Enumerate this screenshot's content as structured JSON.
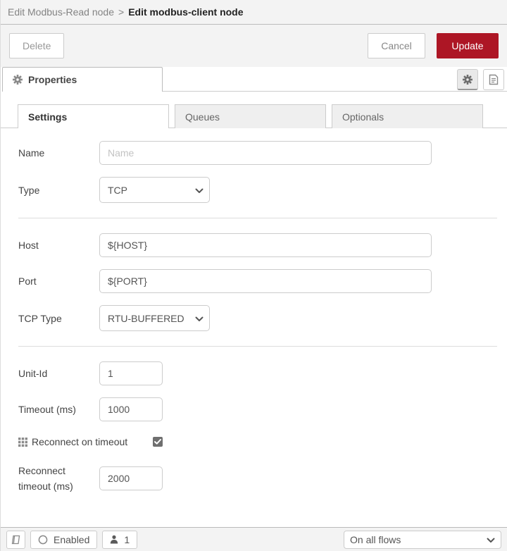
{
  "breadcrumb": {
    "parent": "Edit Modbus-Read node",
    "separator": ">",
    "current": "Edit modbus-client node"
  },
  "toolbar": {
    "delete_label": "Delete",
    "cancel_label": "Cancel",
    "update_label": "Update"
  },
  "properties_tab": {
    "label": "Properties"
  },
  "tabs": [
    {
      "label": "Settings",
      "active": true
    },
    {
      "label": "Queues",
      "active": false
    },
    {
      "label": "Optionals",
      "active": false
    }
  ],
  "form": {
    "name": {
      "label": "Name",
      "value": "",
      "placeholder": "Name"
    },
    "type": {
      "label": "Type",
      "value": "TCP"
    },
    "host": {
      "label": "Host",
      "value": "${HOST}"
    },
    "port": {
      "label": "Port",
      "value": "${PORT}"
    },
    "tcp_type": {
      "label": "TCP Type",
      "value": "RTU-BUFFERED"
    },
    "unit_id": {
      "label": "Unit-Id",
      "value": "1"
    },
    "timeout": {
      "label": "Timeout (ms)",
      "value": "1000"
    },
    "reconnect_on_timeout": {
      "label": "Reconnect on timeout",
      "checked": true
    },
    "reconnect_timeout": {
      "label_line1": "Reconnect",
      "label_line2": "timeout (ms)",
      "value": "2000"
    }
  },
  "footer": {
    "enabled_label": "Enabled",
    "instance_count": "1",
    "scope_value": "On all flows"
  },
  "icons": {
    "gear": "gear",
    "document": "document",
    "book": "book",
    "person": "person",
    "status-circle": "circle-outline",
    "grid": "grid-3x3",
    "check": "checkmark",
    "chevron": "chevron-down"
  },
  "colors": {
    "accent_red": "#AD1625",
    "bar_background": "#f3f3f3",
    "border_strong": "#bbbbbb",
    "border_light": "#cccccc"
  }
}
